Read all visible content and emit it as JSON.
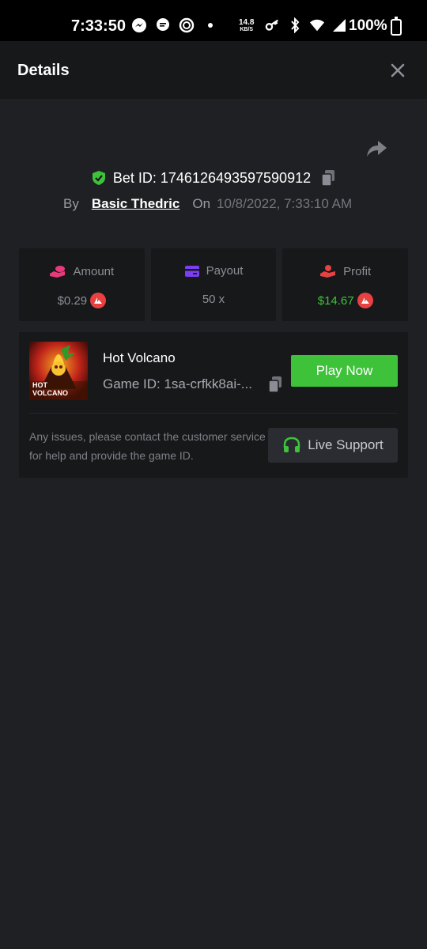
{
  "status_bar": {
    "time": "7:33:50",
    "speed_value": "14.8",
    "speed_unit": "KB/S",
    "battery": "100%"
  },
  "header": {
    "title": "Details"
  },
  "bet": {
    "id_label": "Bet ID: 1746126493597590912",
    "by_label": "By",
    "user": "Basic Thedric",
    "on_label": "On",
    "date": "10/8/2022, 7:33:10 AM"
  },
  "stats": [
    {
      "label": "Amount",
      "value": "$0.29",
      "icon": "coins-hand-icon",
      "color": "#e8397a"
    },
    {
      "label": "Payout",
      "value": "50 x",
      "icon": "card-icon",
      "color": "#7b3ff2"
    },
    {
      "label": "Profit",
      "value": "$14.67",
      "icon": "hand-coin-icon",
      "color": "#e84142"
    }
  ],
  "game": {
    "name": "Hot Volcano",
    "id": "Game ID: 1sa-crfkk8ai-...",
    "play_label": "Play Now",
    "thumb_text": "HOT VOLCANO",
    "help": "Any issues, please contact the customer service for help and provide the game ID.",
    "support_label": "Live Support"
  },
  "colors": {
    "accent_green": "#3ec23a",
    "background": "#1f2023",
    "card": "#17181a"
  }
}
